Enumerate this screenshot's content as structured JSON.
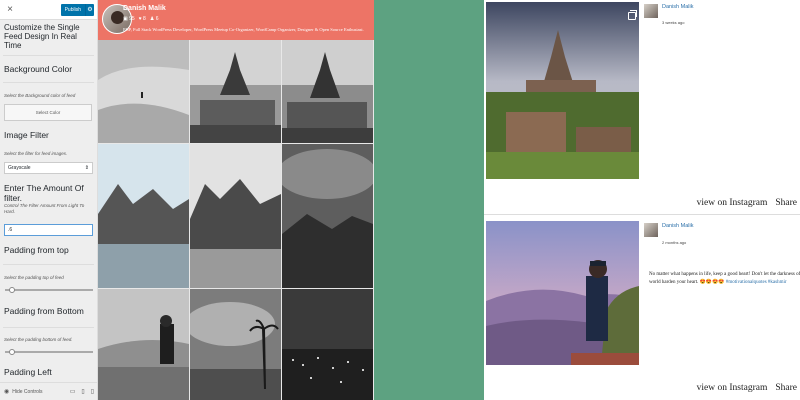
{
  "customizer": {
    "close_icon": "×",
    "publish_label": "Publish",
    "gear_icon": "⚙",
    "intro": "Customize the Single Feed Design In Real Time",
    "background_color": {
      "title": "Background Color",
      "desc": "Select the Background color of feed",
      "button_label": "Select Color"
    },
    "image_filter": {
      "title": "Image Filter",
      "desc": "Select the filter for feed images.",
      "selected": "Grayscale"
    },
    "filter_amount": {
      "title": "Enter The Amount Of filter.",
      "desc": "Control The Filter Amount From Light To Hard.",
      "value": ".6"
    },
    "padding_top": {
      "title": "Padding from top",
      "desc": "Select the padding top of feed"
    },
    "padding_bottom": {
      "title": "Padding from Bottom",
      "desc": "Select the padding bottom of feed."
    },
    "padding_left": {
      "title": "Padding Left"
    },
    "footer": {
      "hide_label": "Hide Controls",
      "hide_icon": "◉",
      "desktop_icon": "▭",
      "tablet_icon": "▯",
      "mobile_icon": "▯"
    }
  },
  "preview": {
    "profile_name": "Danish Malik",
    "stats": [
      "▣ 95",
      "♥ 8",
      "♟ 6"
    ],
    "bio": "PHP, Full Stack WordPress Developer, WordPress Meetup Co-Organizer, WordCamp Organizer, Designer & Open Source Enthusiast.",
    "header_color": "#ed7466"
  },
  "instagram": {
    "posts": [
      {
        "user": "Danish Malik",
        "time": "3 weeks ago",
        "caption": "",
        "view_label": "view on Instagram",
        "share_label": "Share"
      },
      {
        "user": "Danish Malik",
        "time": "2 months ago",
        "caption": "No matter what happens in life, keep a good heart! Don't let the darkness of this world harden your heart. 😍😍😍😍 ",
        "tags": "#motivationalquotes #kashmir",
        "view_label": "view on Instagram",
        "share_label": "Share"
      }
    ]
  }
}
